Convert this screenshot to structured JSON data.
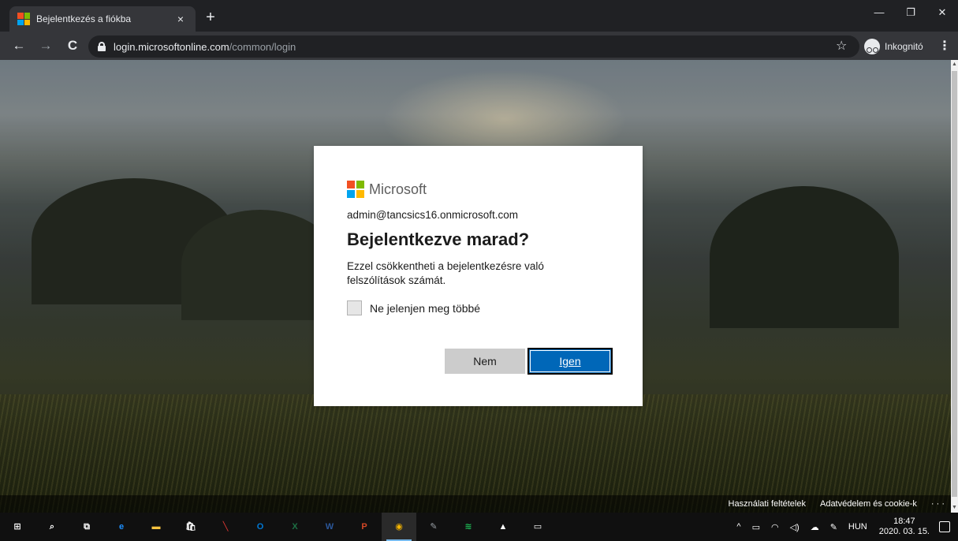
{
  "browser": {
    "tab_title": "Bejelentkezés a fiókba",
    "tab_close": "×",
    "new_tab": "+",
    "window_controls": {
      "minimize": "—",
      "maximize": "❐",
      "close": "✕"
    },
    "nav": {
      "back": "←",
      "forward": "→",
      "reload": "C"
    },
    "url_host": "login.microsoftonline.com",
    "url_path": "/common/login",
    "bookmark_star": "☆",
    "incognito_label": "Inkognitó",
    "menu": "⋮"
  },
  "signin": {
    "brand": "Microsoft",
    "identity": "admin@tancsics16.onmicrosoft.com",
    "heading": "Bejelentkezve marad?",
    "description": "Ezzel csökkentheti a bejelentkezésre való felszólítások számát.",
    "checkbox_label": "Ne jelenjen meg többé",
    "checkbox_checked": false,
    "no_button": "Nem",
    "yes_button": "Igen"
  },
  "footer": {
    "terms": "Használati feltételek",
    "privacy": "Adatvédelem és cookie-k",
    "more": "· · ·"
  },
  "taskbar": {
    "apps": [
      {
        "name": "start",
        "glyph": "⊞",
        "color": "#ffffff"
      },
      {
        "name": "search",
        "glyph": "⌕",
        "color": "#ffffff"
      },
      {
        "name": "task-view",
        "glyph": "⧉",
        "color": "#ffffff"
      },
      {
        "name": "edge",
        "glyph": "e",
        "color": "#1e90ff"
      },
      {
        "name": "file-explorer",
        "glyph": "▬",
        "color": "#f6c33f"
      },
      {
        "name": "store",
        "glyph": "🛍",
        "color": "#ffffff"
      },
      {
        "name": "app-red",
        "glyph": "╲",
        "color": "#e53935"
      },
      {
        "name": "outlook",
        "glyph": "O",
        "color": "#0078d4"
      },
      {
        "name": "excel",
        "glyph": "X",
        "color": "#1d7044"
      },
      {
        "name": "word",
        "glyph": "W",
        "color": "#2b579a"
      },
      {
        "name": "powerpoint",
        "glyph": "P",
        "color": "#d24726"
      },
      {
        "name": "chrome",
        "glyph": "◉",
        "color": "#f4b400"
      },
      {
        "name": "paint",
        "glyph": "✎",
        "color": "#9aa0a6"
      },
      {
        "name": "spotify",
        "glyph": "≋",
        "color": "#1db954"
      },
      {
        "name": "photos",
        "glyph": "▲",
        "color": "#ffffff"
      },
      {
        "name": "terminal",
        "glyph": "▭",
        "color": "#ffffff"
      }
    ],
    "tray": {
      "chevron": "^",
      "language": "HUN",
      "time": "18:47",
      "date": "2020. 03. 15."
    }
  },
  "colors": {
    "ms_red": "#f25022",
    "ms_green": "#7fba00",
    "ms_blue": "#00a4ef",
    "ms_yellow": "#ffb900",
    "primary_button": "#0067b8"
  }
}
